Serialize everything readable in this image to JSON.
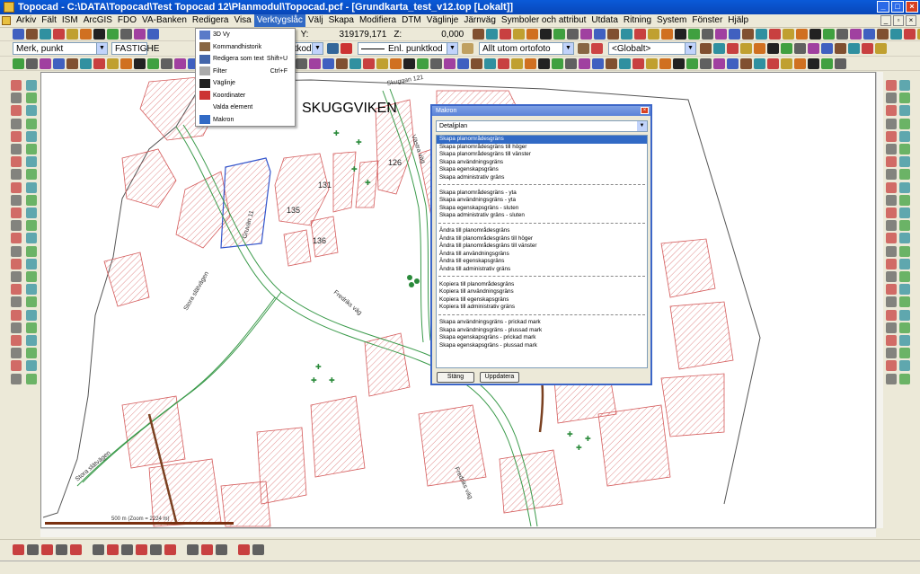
{
  "window": {
    "title": "Topocad - C:\\DATA\\Topocad\\Test Topocad 12\\Planmodul\\Topocad.pcf - [Grundkarta_test_v12.top [Lokalt]]"
  },
  "menubar": {
    "items": [
      "Arkiv",
      "Fält",
      "ISM",
      "ArcGIS",
      "FDO",
      "VA-Banken",
      "Redigera",
      "Visa",
      "Verktygslåc",
      "Välj",
      "Skapa",
      "Modifiera",
      "DTM",
      "Väglinje",
      "Järnväg",
      "Symboler och attribut",
      "Utdata",
      "Ritning",
      "System",
      "Fönster",
      "Hjälp"
    ],
    "active_index": 8
  },
  "toolbar1": {
    "y_label": "Y:",
    "y_value": "319179,171",
    "z_label": "Z:",
    "z_value": "0,000",
    "n_value": "3"
  },
  "toolbar2": {
    "mark_combo": "Merk, punkt",
    "fastighet_combo": "FASTIGHE",
    "punktkod_combo": "Enl. punktkod",
    "line_combo": "Enl. punktkod",
    "ortofoto_combo": "Allt utom ortofoto",
    "global_combo": "<Globalt>"
  },
  "tools_menu": {
    "items": [
      {
        "label": "3D Vy",
        "shortcut": "",
        "icon": "cube-icon"
      },
      {
        "label": "Kommandhistorik",
        "shortcut": "",
        "icon": "history-icon"
      },
      {
        "label": "Redigera som text",
        "shortcut": "Shift+U",
        "icon": "text-edit-icon"
      },
      {
        "label": "Filter",
        "shortcut": "Ctrl+F",
        "icon": "filter-icon"
      },
      {
        "label": "Väglinje",
        "shortcut": "",
        "icon": "road-icon"
      },
      {
        "label": "Koordinater",
        "shortcut": "",
        "icon": "xyz-icon"
      },
      {
        "label": "Valda element",
        "shortcut": "",
        "icon": ""
      },
      {
        "label": "Makron",
        "shortcut": "",
        "icon": "check-icon"
      }
    ]
  },
  "map": {
    "place_label": "SKUGGVIKEN",
    "parcel_labels": [
      "126",
      "131",
      "135",
      "136"
    ],
    "road_labels": [
      "Gruvän 11",
      "Stora slätvägen",
      "Stora slätvägen",
      "Fredriks väg",
      "Fredriks väg",
      "Västra väg",
      "Skuggan 121"
    ],
    "scale_text": "500 m (Zoom = 2224 m)"
  },
  "makron_dialog": {
    "title": "Makron",
    "category": "Detaljplan",
    "groups": [
      [
        "Skapa planområdesgräns",
        "Skapa planområdesgräns till höger",
        "Skapa planområdesgräns till vänster",
        "Skapa användningsgräns",
        "Skapa egenskapsgräns",
        "Skapa administrativ gräns"
      ],
      [
        "Skapa planområdesgräns - yta",
        "Skapa användningsgräns - yta",
        "Skapa egenskapsgräns - sluten",
        "Skapa administrativ gräns - sluten"
      ],
      [
        "Ändra till planområdesgräns",
        "Ändra till planområdesgräns till höger",
        "Ändra till planområdesgräns till vänster",
        "Ändra till användningsgräns",
        "Ändra till egenskapsgräns",
        "Ändra till administrativ gräns"
      ],
      [
        "Kopiera till planområdesgräns",
        "Kopiera till användningsgräns",
        "Kopiera till egenskapsgräns",
        "Kopiera till administrativ gräns"
      ],
      [
        "Skapa användningsgräns - prickad mark",
        "Skapa användningsgräns - plussad mark",
        "Skapa egenskapsgräns - prickad mark",
        "Skapa egenskapsgräns - plussad mark"
      ]
    ],
    "close_button": "Stäng",
    "update_button": "Uppdatera"
  },
  "colors": {
    "parcel": "#d45a5a",
    "road": "#3a9a4a",
    "selection": "#316ac5",
    "title_blue": "#0a5ad8"
  }
}
